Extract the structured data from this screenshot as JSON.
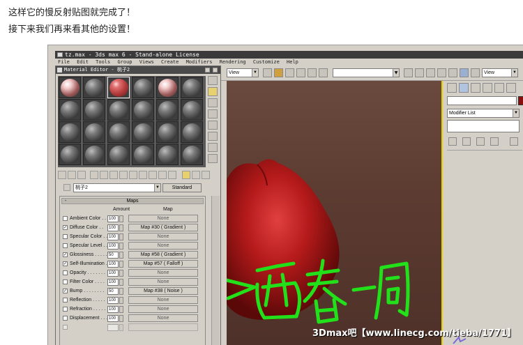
{
  "captions": {
    "line1": "这样它的慢反射贴图就完成了！",
    "line2": "接下来我们再来看其他的设置！"
  },
  "app": {
    "window_title": "tz.max - 3ds max 6 - Stand-alone License",
    "menu": [
      "File",
      "Edit",
      "Tools",
      "Group",
      "Views",
      "Create",
      "Modifiers",
      "Rendering",
      "Customize",
      "Help"
    ],
    "view_dropdown_left": "View",
    "view_dropdown_right": "View"
  },
  "material_editor": {
    "title": "Material Editor - 桃子2",
    "material_name": "桃子2",
    "type_button": "Standard",
    "maps_rollout_title": "Maps",
    "collapse_symbol": "-",
    "col_amount": "Amount",
    "col_map": "Map",
    "rows": [
      {
        "label": "Ambient Color . .",
        "checked": false,
        "amount": "100",
        "map": "None"
      },
      {
        "label": "Diffuse Color . .",
        "checked": true,
        "amount": "100",
        "map": "Map #30  ( Gradient )"
      },
      {
        "label": "Specular Color . .",
        "checked": false,
        "amount": "100",
        "map": "None"
      },
      {
        "label": "Specular Level . .",
        "checked": false,
        "amount": "100",
        "map": "None"
      },
      {
        "label": "Glossiness . . . . .",
        "checked": true,
        "amount": "50",
        "map": "Map #58  ( Gradient )"
      },
      {
        "label": "Self-Illumination .",
        "checked": true,
        "amount": "100",
        "map": "Map #57  ( Falloff )"
      },
      {
        "label": "Opacity . . . . . . .",
        "checked": false,
        "amount": "100",
        "map": "None"
      },
      {
        "label": "Filter Color . . . .",
        "checked": false,
        "amount": "100",
        "map": "None"
      },
      {
        "label": "Bump . . . . . . . .",
        "checked": true,
        "amount": "50",
        "map": "Map #38  ( Noise )"
      },
      {
        "label": "Reflection . . . . .",
        "checked": false,
        "amount": "100",
        "map": "None"
      },
      {
        "label": "Refraction . . . . .",
        "checked": false,
        "amount": "100",
        "map": "None"
      },
      {
        "label": "Displacement . . .",
        "checked": false,
        "amount": "100",
        "map": "None"
      }
    ]
  },
  "command_panel": {
    "modifier_list": "Modifier List"
  },
  "overlay": {
    "handwriting": ">西着一周",
    "watermark": "3Dmax吧【www.linecg.com/tieba/1771】"
  },
  "colors": {
    "viewport_bg": "#5d3c32",
    "peach": "#b01818",
    "handwriting": "#22e01a",
    "selection_band": "#f0dc00"
  }
}
